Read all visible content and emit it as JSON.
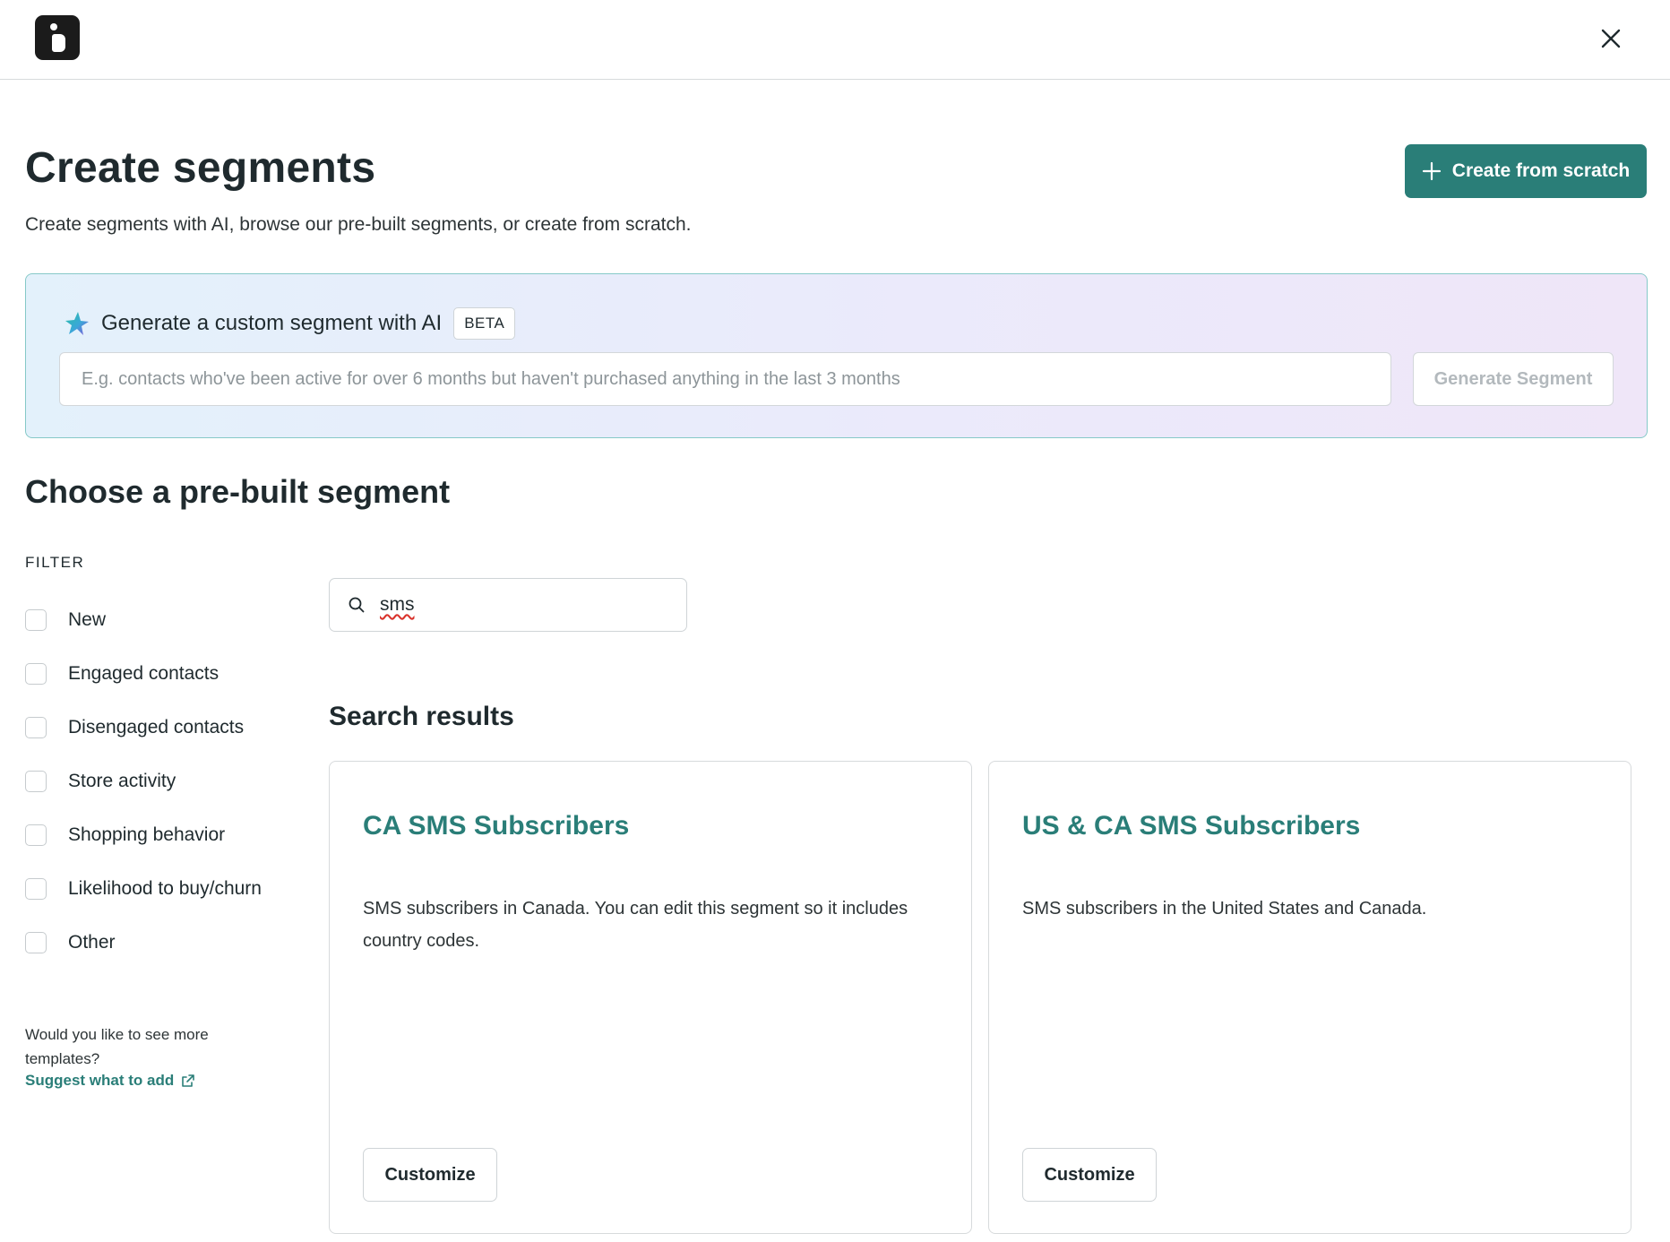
{
  "header": {
    "logo_icon": "brand-logo-icon",
    "close_icon": "close-icon"
  },
  "page": {
    "title": "Create segments",
    "subtitle": "Create segments with AI, browse our pre-built segments, or create from scratch.",
    "create_button_label": "Create from scratch"
  },
  "ai": {
    "title": "Generate a custom segment with AI",
    "badge": "BETA",
    "input_value": "",
    "input_placeholder": "E.g. contacts who've been active for over 6 months but haven't purchased anything in the last 3 months",
    "generate_button_label": "Generate Segment"
  },
  "prebuilt": {
    "title": "Choose a pre-built segment",
    "filter_label": "FILTER",
    "filters": [
      {
        "label": "New",
        "checked": false
      },
      {
        "label": "Engaged contacts",
        "checked": false
      },
      {
        "label": "Disengaged contacts",
        "checked": false
      },
      {
        "label": "Store activity",
        "checked": false
      },
      {
        "label": "Shopping behavior",
        "checked": false
      },
      {
        "label": "Likelihood to buy/churn",
        "checked": false
      },
      {
        "label": "Other",
        "checked": false
      }
    ],
    "suggest_text": "Would you like to see more templates?",
    "suggest_link": "Suggest what to add"
  },
  "search": {
    "value": "sms"
  },
  "results": {
    "title": "Search results",
    "cards": [
      {
        "title": "CA SMS Subscribers",
        "description": "SMS subscribers in Canada. You can edit this segment so it includes country codes.",
        "button_label": "Customize"
      },
      {
        "title": "US & CA SMS Subscribers",
        "description": "SMS subscribers in the United States and Canada.",
        "button_label": "Customize"
      }
    ]
  },
  "colors": {
    "accent": "#2a7e78",
    "text": "#1f2a2e",
    "border": "#d7dadc"
  }
}
